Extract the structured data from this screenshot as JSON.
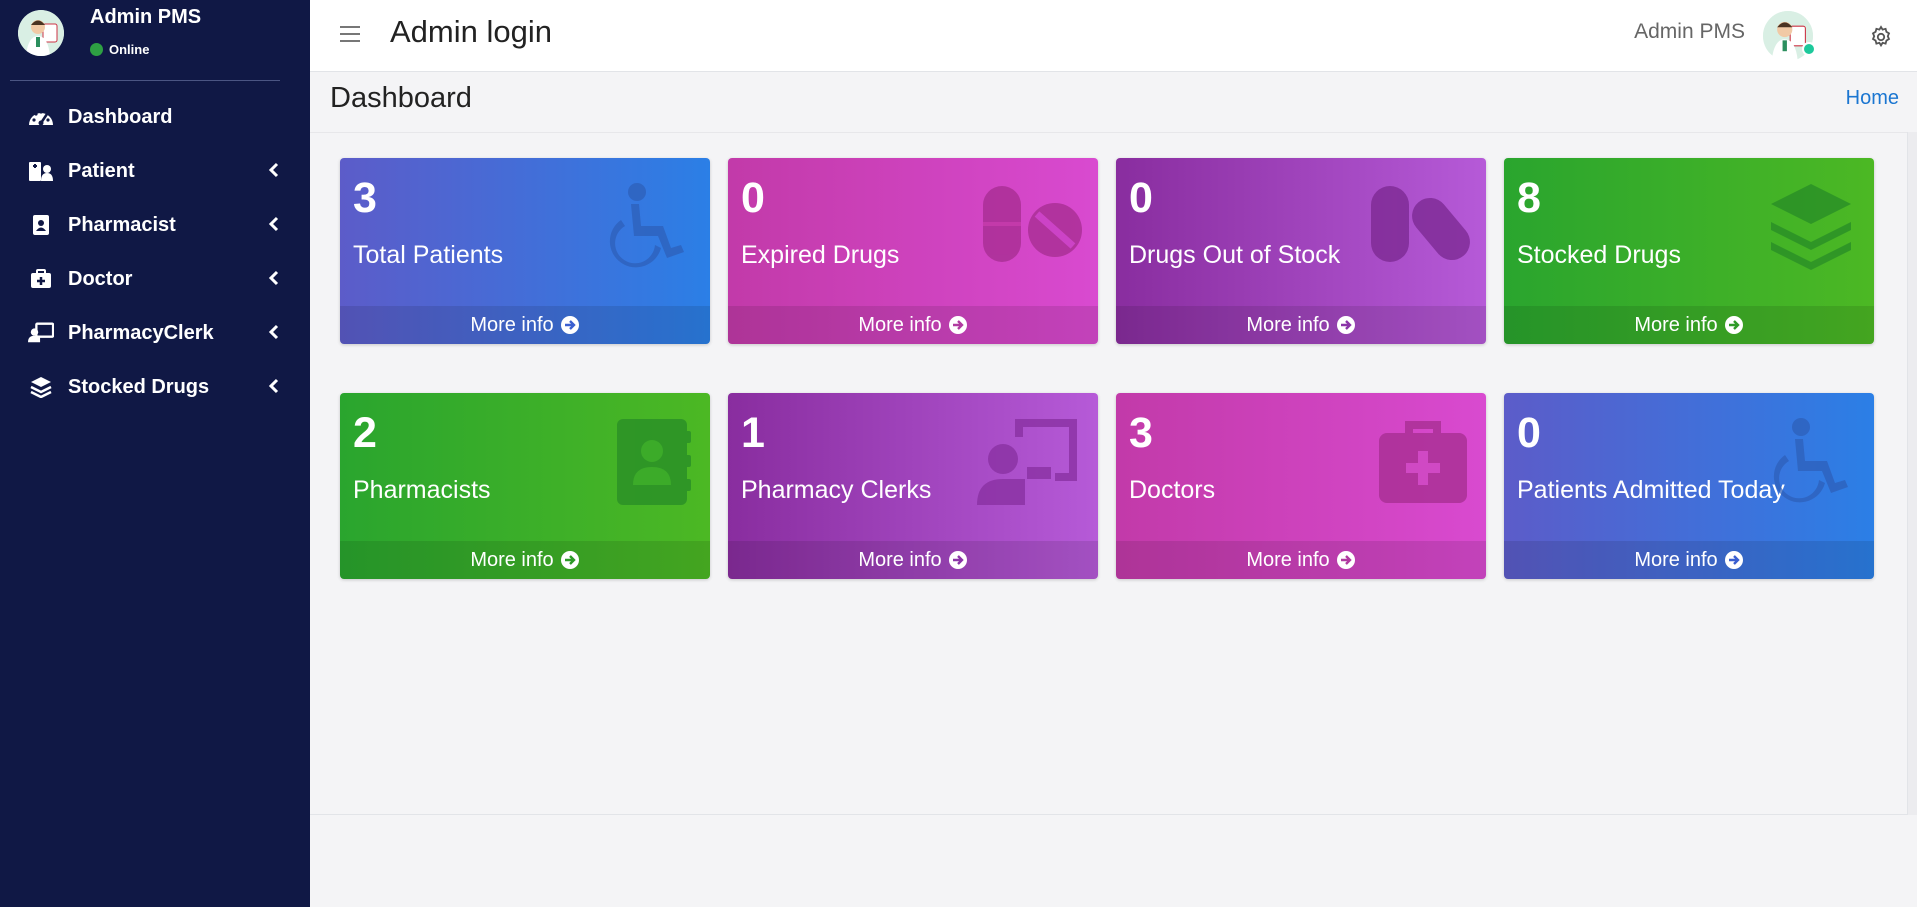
{
  "sidebar": {
    "user": {
      "name": "Admin PMS",
      "status": "Online"
    },
    "items": [
      {
        "label": "Dashboard",
        "icon": "gauge-icon",
        "has_submenu": false
      },
      {
        "label": "Patient",
        "icon": "hospital-user-icon",
        "has_submenu": true
      },
      {
        "label": "Pharmacist",
        "icon": "id-badge-icon",
        "has_submenu": true
      },
      {
        "label": "Doctor",
        "icon": "medkit-icon",
        "has_submenu": true
      },
      {
        "label": "PharmacyClerk",
        "icon": "chalkboard-teacher-icon",
        "has_submenu": true
      },
      {
        "label": "Stocked Drugs",
        "icon": "layers-icon",
        "has_submenu": true
      }
    ]
  },
  "header": {
    "title": "Admin login",
    "user_name": "Admin PMS"
  },
  "page": {
    "title": "Dashboard",
    "breadcrumb_home": "Home"
  },
  "cards": [
    {
      "value": "3",
      "label": "Total Patients",
      "more": "More info",
      "icon": "wheelchair-icon",
      "color": "#2b7fe6"
    },
    {
      "value": "0",
      "label": "Expired Drugs",
      "more": "More info",
      "icon": "pill-ban-icon",
      "color": "#d94ad0"
    },
    {
      "value": "0",
      "label": "Drugs Out of Stock",
      "more": "More info",
      "icon": "pills-icon",
      "color": "#b65ad8"
    },
    {
      "value": "8",
      "label": "Stocked Drugs",
      "more": "More info",
      "icon": "layers-icon",
      "color": "#4cb824"
    },
    {
      "value": "2",
      "label": "Pharmacists",
      "more": "More info",
      "icon": "address-book-icon",
      "color": "#4cb824"
    },
    {
      "value": "1",
      "label": "Pharmacy Clerks",
      "more": "More info",
      "icon": "chalkboard-teacher-icon",
      "color": "#b65ad8"
    },
    {
      "value": "3",
      "label": "Doctors",
      "more": "More info",
      "icon": "medkit-icon",
      "color": "#d94ad0"
    },
    {
      "value": "0",
      "label": "Patients Admitted Today",
      "more": "More info",
      "icon": "wheelchair-icon",
      "color": "#2b7fe6"
    }
  ]
}
